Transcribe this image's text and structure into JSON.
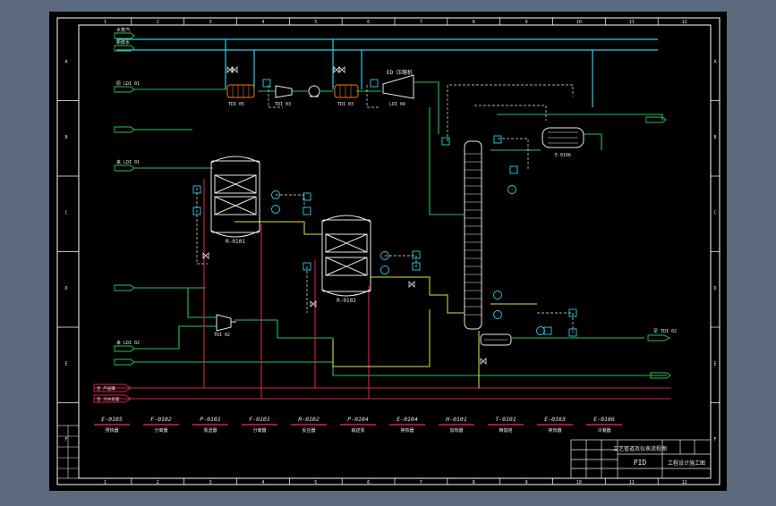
{
  "colors": {
    "viewport": "#5b6a7c",
    "sheet": "#000000",
    "frame": "#ffffff",
    "process": "#22c55e",
    "steam": "#e11d48",
    "utility": "#22d3ee",
    "product": "#e5e04a",
    "equipment": "#e8e8e8",
    "instrument": "#22d3ee"
  },
  "grid": {
    "columns": [
      "1",
      "2",
      "3",
      "4",
      "5",
      "6",
      "7",
      "8",
      "9",
      "10",
      "11",
      "12"
    ],
    "rows": [
      "A",
      "B",
      "C",
      "D",
      "E",
      "F"
    ]
  },
  "streams": {
    "left": [
      "水蒸汽",
      "新鲜水",
      "原 LDI 01",
      "",
      "来 LDI 01",
      "",
      "",
      "",
      "来 LDI 02",
      ""
    ],
    "bottom": [
      "至 产品罐",
      "至 污水处理"
    ],
    "right": [
      "至 TDI 02"
    ]
  },
  "equipment_tags": [
    "E-0105",
    "F-0102",
    "P-0101",
    "F-0101",
    "R-0102",
    "P-0104",
    "E-0104",
    "H-0101",
    "T-0101",
    "E-0103",
    "E-0106"
  ],
  "equipment_names": [
    "预热器",
    "分离器",
    "泵送器",
    "分离器",
    "反应器",
    "输送泵",
    "换热器",
    "加热器",
    "精馏塔",
    "换热器",
    "冷凝器"
  ],
  "labels": {
    "compressor_tag": "ED 压缩机",
    "reactor1": "R-0101",
    "reactor2": "R-0102",
    "col_exchanger": "E-0106",
    "hx1": "TDI 05",
    "hx2": "TDI 03",
    "hx3": "LDI 04",
    "pump1": "TDI 03",
    "pump2": "TDI 02"
  },
  "title_block": {
    "company": "工艺管道及仪表流程图",
    "drawing_title": "PID",
    "drawing_no": "工程设计施工图"
  }
}
